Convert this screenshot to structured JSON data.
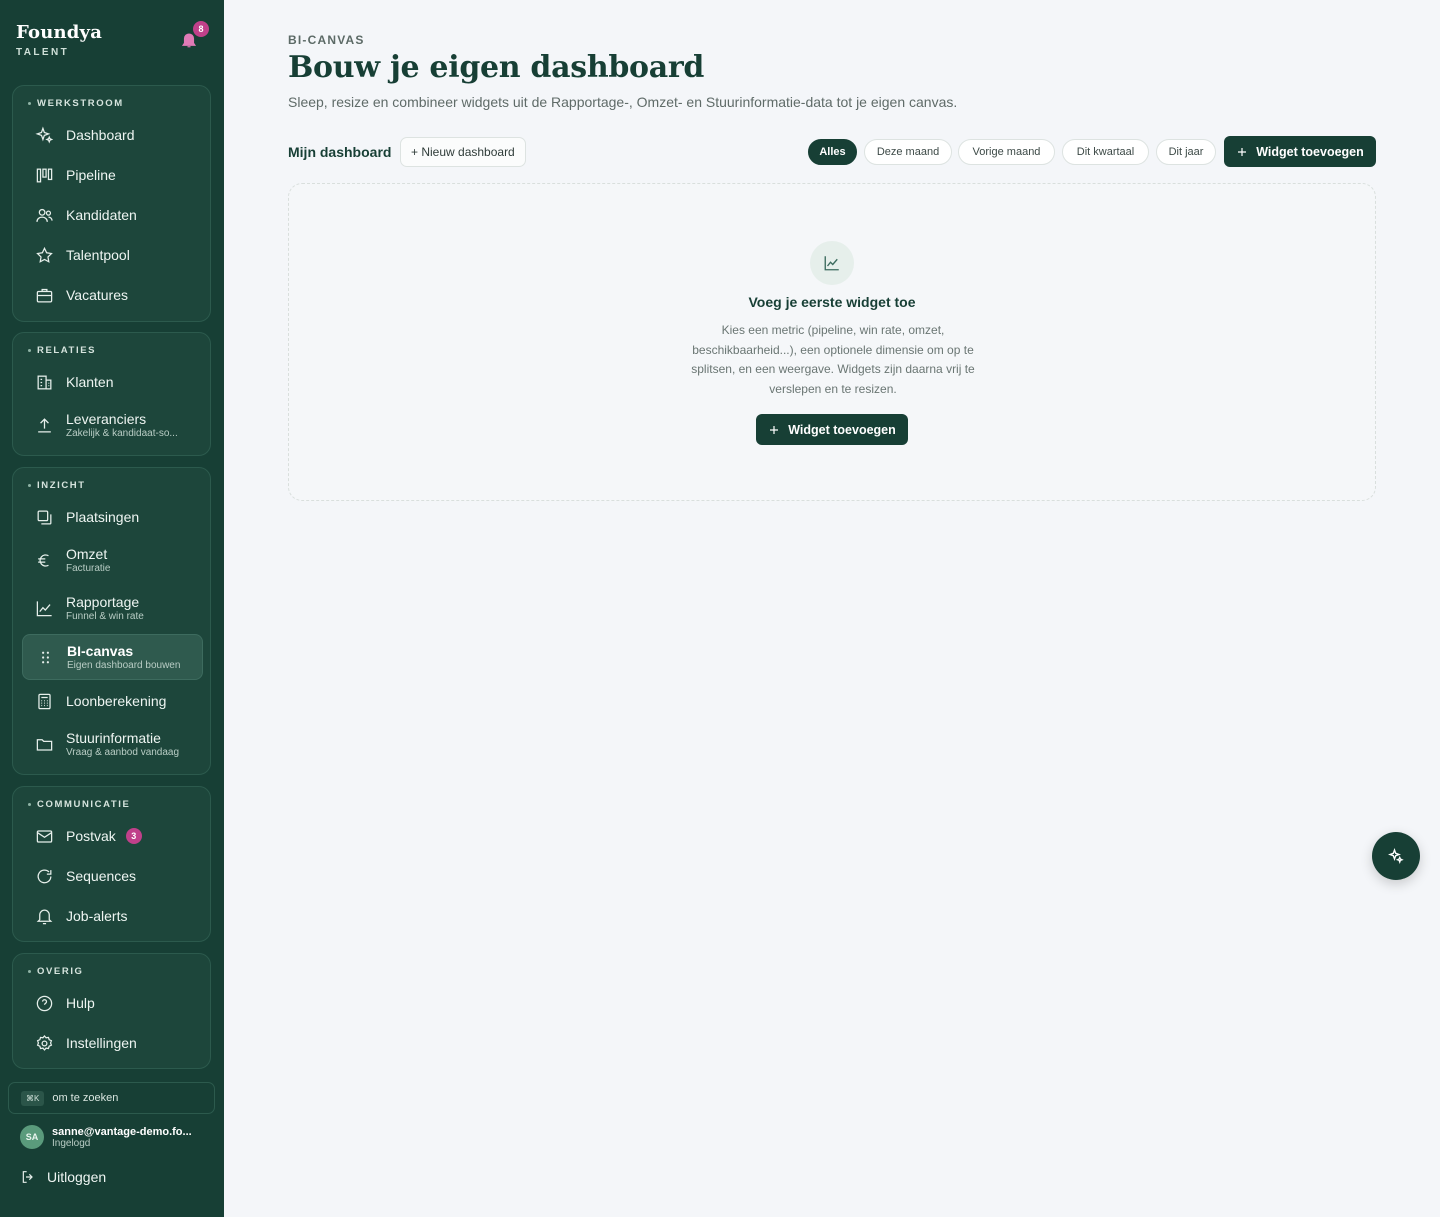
{
  "brand": {
    "name": "Foundya",
    "sub": "TALENT",
    "notifications": "8"
  },
  "groups": [
    {
      "title": "WERKSTROOM",
      "items": [
        {
          "label": "Dashboard",
          "icon": "sparkles-icon"
        },
        {
          "label": "Pipeline",
          "icon": "kanban-icon"
        },
        {
          "label": "Kandidaten",
          "icon": "users-icon"
        },
        {
          "label": "Talentpool",
          "icon": "star-icon"
        },
        {
          "label": "Vacatures",
          "icon": "briefcase-icon"
        }
      ]
    },
    {
      "title": "RELATIES",
      "items": [
        {
          "label": "Klanten",
          "icon": "building-icon"
        },
        {
          "label": "Leveranciers",
          "sub": "Zakelijk & kandidaat-so...",
          "icon": "upload-icon"
        }
      ]
    },
    {
      "title": "INZICHT",
      "items": [
        {
          "label": "Plaatsingen",
          "icon": "copy-icon"
        },
        {
          "label": "Omzet",
          "sub": "Facturatie",
          "icon": "euro-icon"
        },
        {
          "label": "Rapportage",
          "sub": "Funnel & win rate",
          "icon": "line-chart-icon"
        },
        {
          "label": "BI-canvas",
          "sub": "Eigen dashboard bouwen",
          "icon": "grip-icon"
        },
        {
          "label": "Loonberekening",
          "icon": "calculator-icon"
        },
        {
          "label": "Stuurinformatie",
          "sub": "Vraag & aanbod vandaag",
          "icon": "folder-icon"
        }
      ]
    },
    {
      "title": "COMMUNICATIE",
      "items": [
        {
          "label": "Postvak",
          "badge": "3",
          "icon": "mail-icon"
        },
        {
          "label": "Sequences",
          "icon": "refresh-icon"
        },
        {
          "label": "Job-alerts",
          "icon": "bell-icon"
        }
      ]
    },
    {
      "title": "OVERIG",
      "items": [
        {
          "label": "Hulp",
          "icon": "help-icon"
        },
        {
          "label": "Instellingen",
          "icon": "settings-icon"
        }
      ]
    }
  ],
  "search": {
    "kbd": "⌘K",
    "text": "om te zoeken"
  },
  "user": {
    "initials": "SA",
    "email": "sanne@vantage-demo.fo...",
    "status": "Ingelogd"
  },
  "logout": "Uitloggen",
  "header": {
    "eyebrow": "BI-CANVAS",
    "title": "Bouw je eigen dashboard",
    "description": "Sleep, resize en combineer widgets uit de Rapportage-, Omzet- en Stuurinformatie-data tot je eigen canvas."
  },
  "toolbar": {
    "dashboard_name": "Mijn dashboard",
    "new_dashboard": "+ Nieuw dashboard",
    "filters": [
      "Alles",
      "Deze maand",
      "Vorige maand",
      "Dit kwartaal",
      "Dit jaar"
    ],
    "active_filter": "Alles",
    "add_widget": "Widget toevoegen"
  },
  "empty_state": {
    "title": "Voeg je eerste widget toe",
    "description": "Kies een metric (pipeline, win rate, omzet, beschikbaarheid...), een optionele dimensie om op te splitsen, en een weergave. Widgets zijn daarna vrij te verslepen en te resizen.",
    "button": "Widget toevoegen"
  },
  "colors": {
    "sidebar": "#173f35",
    "accent": "#173f35",
    "badge": "#c0408a",
    "background": "#f4f6f9"
  }
}
